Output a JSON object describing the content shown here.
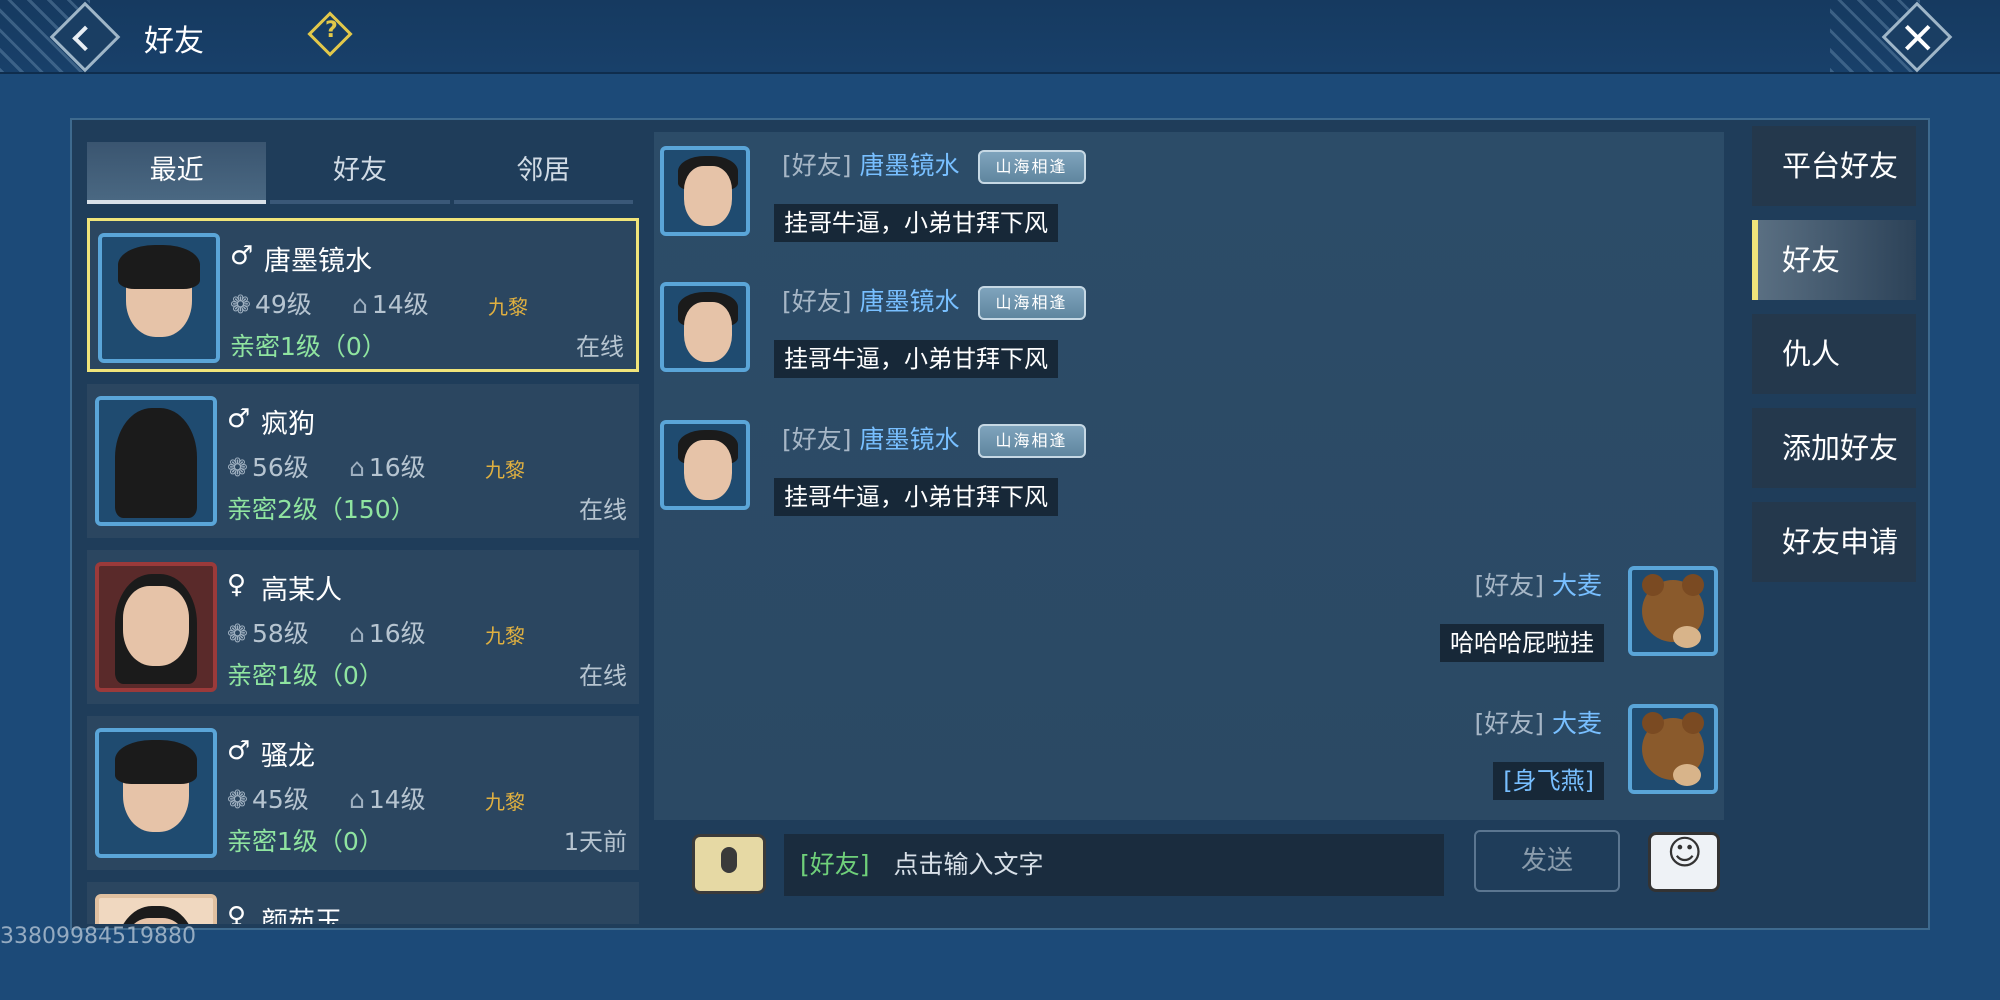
{
  "header": {
    "title": "好友",
    "help_icon": "help-icon",
    "close_icon": "close-icon"
  },
  "left_tabs": [
    {
      "label": "最近",
      "active": true
    },
    {
      "label": "好友",
      "active": false
    },
    {
      "label": "邻居",
      "active": false
    }
  ],
  "friends": [
    {
      "gender": "♂",
      "name": "唐墨镜水",
      "level": "49级",
      "home": "14级",
      "clan": "九黎",
      "intimacy": "亲密1级（0）",
      "status": "在线",
      "selected": true
    },
    {
      "gender": "♂",
      "name": "疯狗",
      "level": "56级",
      "home": "16级",
      "clan": "九黎",
      "intimacy": "亲密2级（150）",
      "status": "在线",
      "selected": false
    },
    {
      "gender": "♀",
      "name": "高某人",
      "level": "58级",
      "home": "16级",
      "clan": "九黎",
      "intimacy": "亲密1级（0）",
      "status": "在线",
      "selected": false
    },
    {
      "gender": "♂",
      "name": "骚龙",
      "level": "45级",
      "home": "14级",
      "clan": "九黎",
      "intimacy": "亲密1级（0）",
      "status": "1天前",
      "selected": false
    },
    {
      "gender": "♀",
      "name": "颜茹玉",
      "level": "",
      "home": "",
      "clan": "",
      "intimacy": "",
      "status": "",
      "selected": false
    }
  ],
  "messages": [
    {
      "side": "left",
      "channel": "[好友]",
      "name": "唐墨镜水",
      "badge": "山海相逢",
      "text": "挂哥牛逼，小弟甘拜下风"
    },
    {
      "side": "left",
      "channel": "[好友]",
      "name": "唐墨镜水",
      "badge": "山海相逢",
      "text": "挂哥牛逼，小弟甘拜下风"
    },
    {
      "side": "left",
      "channel": "[好友]",
      "name": "唐墨镜水",
      "badge": "山海相逢",
      "text": "挂哥牛逼，小弟甘拜下风"
    },
    {
      "side": "right",
      "channel": "[好友]",
      "name": "大麦",
      "badge": "",
      "text": "哈哈哈屁啦挂"
    },
    {
      "side": "right",
      "channel": "[好友]",
      "name": "大麦",
      "badge": "",
      "text": "[身飞燕]"
    }
  ],
  "input": {
    "channel": "[好友]",
    "placeholder": "点击输入文字",
    "send_label": "发送"
  },
  "side_menu": [
    {
      "label": "平台好友",
      "active": false
    },
    {
      "label": "好友",
      "active": true
    },
    {
      "label": "仇人",
      "active": false
    },
    {
      "label": "添加好友",
      "active": false
    },
    {
      "label": "好友申请",
      "active": false
    }
  ],
  "watermark": "33809984519880"
}
